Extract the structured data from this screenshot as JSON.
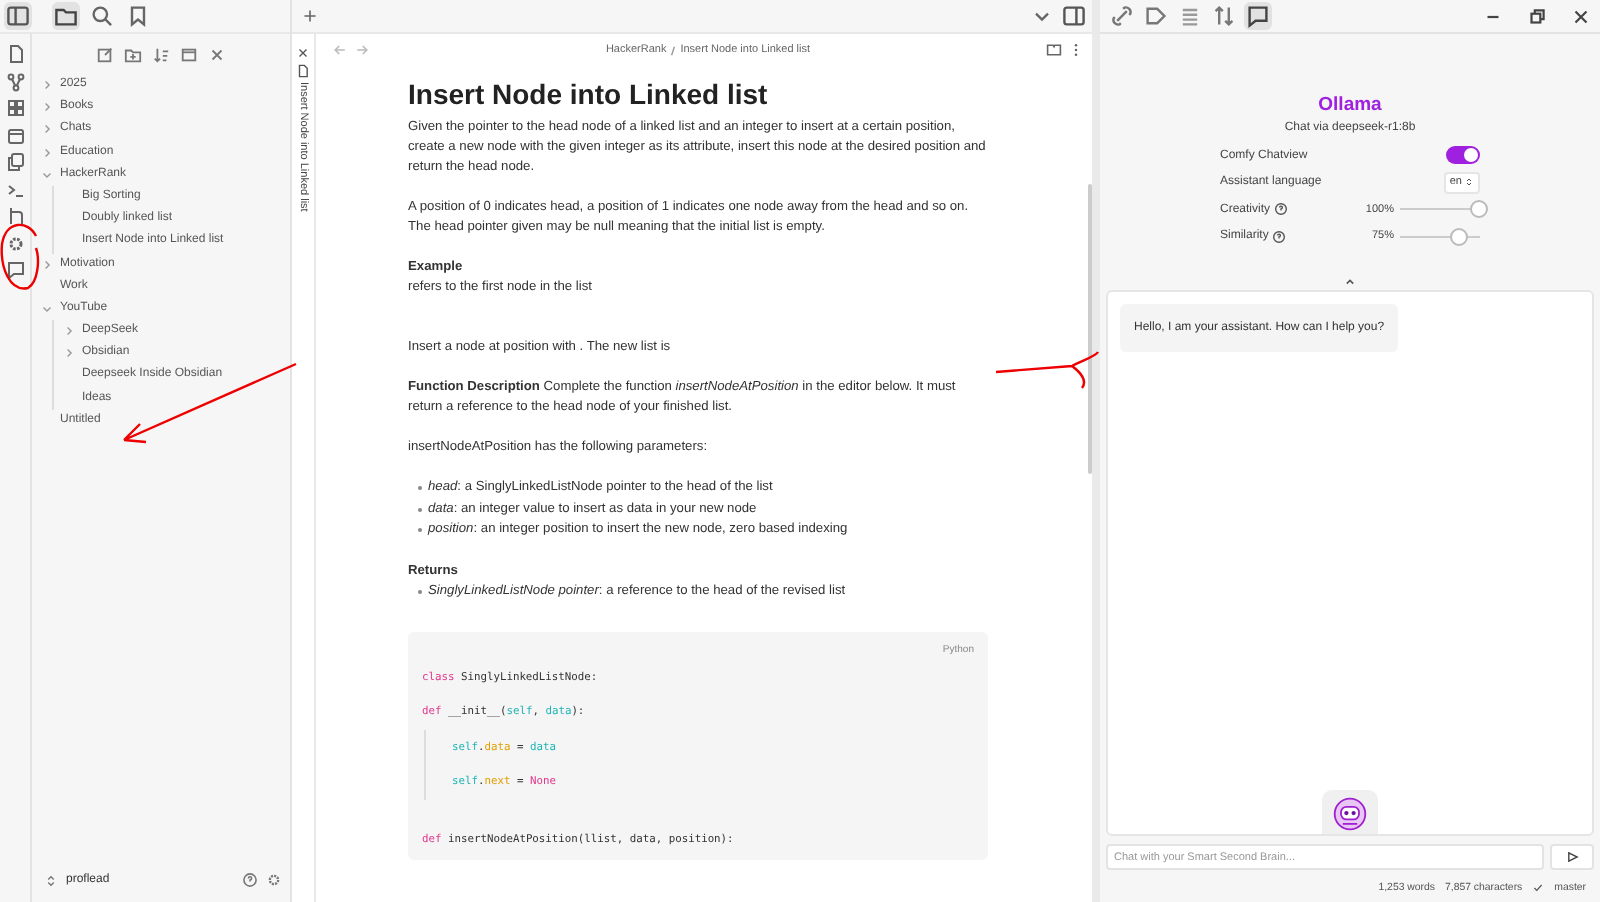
{
  "explorer": {
    "tree": [
      {
        "label": "2025",
        "kind": "folder",
        "expanded": false
      },
      {
        "label": "Books",
        "kind": "folder",
        "expanded": false
      },
      {
        "label": "Chats",
        "kind": "folder",
        "expanded": false
      },
      {
        "label": "Education",
        "kind": "folder",
        "expanded": false
      },
      {
        "label": "HackerRank",
        "kind": "folder",
        "expanded": true,
        "children": [
          {
            "label": "Big Sorting",
            "kind": "file"
          },
          {
            "label": "Doubly linked list",
            "kind": "file"
          },
          {
            "label": "Insert Node into Linked list",
            "kind": "file"
          }
        ]
      },
      {
        "label": "Motivation",
        "kind": "folder",
        "expanded": false
      },
      {
        "label": "Work",
        "kind": "file"
      },
      {
        "label": "YouTube",
        "kind": "folder",
        "expanded": true,
        "children": [
          {
            "label": "DeepSeek",
            "kind": "folder",
            "expanded": false
          },
          {
            "label": "Obsidian",
            "kind": "folder",
            "expanded": false
          },
          {
            "label": "Deepseek Inside Obsidian",
            "kind": "file"
          },
          {
            "label": "Ideas",
            "kind": "file"
          }
        ]
      },
      {
        "label": "Untitled",
        "kind": "file"
      }
    ],
    "vault": "proflead"
  },
  "tab": {
    "title": "Insert Node into Linked list"
  },
  "breadcrumb": [
    "HackerRank",
    "Insert Node into Linked list"
  ],
  "document": [
    {
      "kind": "title",
      "text": "Insert Node into Linked list"
    },
    {
      "kind": "paragraph",
      "text": "Given the pointer to the head node of a linked list and an integer to insert at a certain position, create a new node with the given integer as its  attribute, insert this node at the desired position and return the head node."
    },
    {
      "kind": "paragraph",
      "text": "A position of 0 indicates head, a position of 1 indicates one node away from the head and so on. The head pointer given may be null meaning that the initial list is empty."
    },
    {
      "kind": "label",
      "text": "Example"
    },
    {
      "kind": "line",
      "text": "refers to the first node in the list"
    },
    {
      "kind": "gap"
    },
    {
      "kind": "paragraph",
      "text": "Insert a node at position  with . The new list is"
    },
    {
      "kind": "paragraph",
      "text": "**Function Description** Complete the function *insertNodeAtPosition* in the editor below. It must return a reference to the head node of your finished list."
    },
    {
      "kind": "paragraph",
      "text": "insertNodeAtPosition has the following parameters:"
    },
    {
      "kind": "list",
      "items": [
        "*head*: a SinglyLinkedListNode pointer to the head of the list",
        "*data*: an integer value to insert as data in your new node",
        "*position*: an integer position to insert the new node, zero based indexing"
      ]
    },
    {
      "kind": "label",
      "text": "Returns"
    },
    {
      "kind": "list",
      "items": [
        "*SinglyLinkedListNode pointer*: a reference to the head of the revised list"
      ]
    },
    {
      "kind": "code",
      "language": "Python",
      "lines": [
        {
          "indent": false,
          "tokens": [
            {
              "text": "class",
              "kind": "keyword"
            },
            {
              "text": " SinglyLinkedListNode:",
              "kind": "plain"
            }
          ]
        },
        {
          "indent": false,
          "tokens": [
            {
              "text": "def",
              "kind": "keyword"
            },
            {
              "text": " __init__(",
              "kind": "plain"
            },
            {
              "text": "self",
              "kind": "variable"
            },
            {
              "text": ", ",
              "kind": "plain"
            },
            {
              "text": "data",
              "kind": "variable"
            },
            {
              "text": "):",
              "kind": "plain"
            }
          ]
        },
        {
          "indent": true,
          "tokens": [
            {
              "text": "self",
              "kind": "variable"
            },
            {
              "text": ".",
              "kind": "plain"
            },
            {
              "text": "data",
              "kind": "property"
            },
            {
              "text": " = ",
              "kind": "plain"
            },
            {
              "text": "data",
              "kind": "variable"
            }
          ]
        },
        {
          "indent": true,
          "tokens": [
            {
              "text": "self",
              "kind": "variable"
            },
            {
              "text": ".",
              "kind": "plain"
            },
            {
              "text": "next",
              "kind": "property"
            },
            {
              "text": " = ",
              "kind": "plain"
            },
            {
              "text": "None",
              "kind": "keyword"
            }
          ]
        },
        {
          "indent": false,
          "gap": true,
          "tokens": [
            {
              "text": "def",
              "kind": "keyword"
            },
            {
              "text": " insertNodeAtPosition(llist, data, position):",
              "kind": "plain"
            }
          ]
        }
      ]
    }
  ],
  "assistant": {
    "title": "Ollama",
    "subtitle": "Chat via deepseek-r1:8b",
    "settings": [
      {
        "kind": "switch",
        "label": "Comfy Chatview",
        "on": true
      },
      {
        "kind": "select",
        "label": "Assistant language",
        "value": "en"
      },
      {
        "kind": "slider",
        "label": "Creativity",
        "help": true,
        "reading": "100%",
        "level": 1.0
      },
      {
        "kind": "slider",
        "label": "Similarity",
        "help": true,
        "reading": "75%",
        "level": 0.75
      }
    ],
    "messages": [
      "Hello, I am your assistant. How can I help you?"
    ],
    "input": {
      "placeholder": "Chat with your Smart Second Brain..."
    }
  },
  "status_bar": {
    "words": "1,253 words",
    "characters": "7,857 characters",
    "branch": "master"
  }
}
